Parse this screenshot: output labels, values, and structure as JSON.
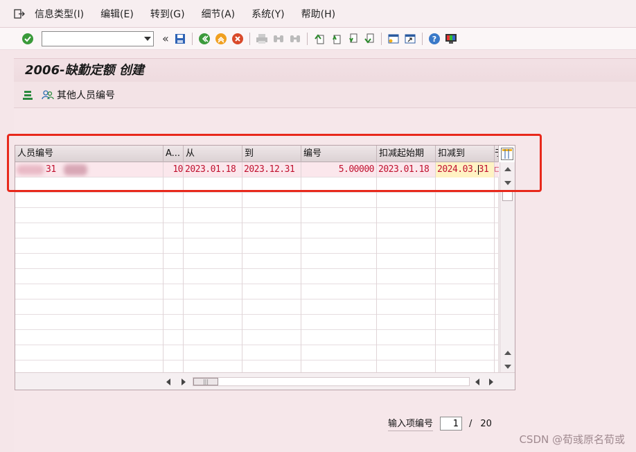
{
  "menu": {
    "items": [
      "信息类型(I)",
      "编辑(E)",
      "转到(G)",
      "细节(A)",
      "系统(Y)",
      "帮助(H)"
    ]
  },
  "toolbar": {
    "command_value": "",
    "history_chevron": "«"
  },
  "title": "2006-缺勤定额 创建",
  "app_toolbar": {
    "other_persons_label": "其他人员编号"
  },
  "table": {
    "headers": [
      "人员编号",
      "A...",
      "从",
      "到",
      "编号",
      "扣减起始期",
      "扣减到",
      "于"
    ],
    "rows": [
      {
        "pernr_suffix": "31",
        "a": "10",
        "from": "2023.01.18",
        "to": "2023.12.31",
        "number": "5.00000",
        "deduct_from": "2023.01.18",
        "deduct_to_before": "2024.03.",
        "deduct_to_after": "31"
      }
    ]
  },
  "footer": {
    "entry_label": "输入项编号",
    "entry_current": "1",
    "separator": "/",
    "entry_total": "20"
  },
  "watermark": "CSDN @荀彧原名荀或",
  "colors": {
    "highlight_box": "#e8281b",
    "row_text": "#c0102e",
    "background": "#f5e6e9"
  }
}
